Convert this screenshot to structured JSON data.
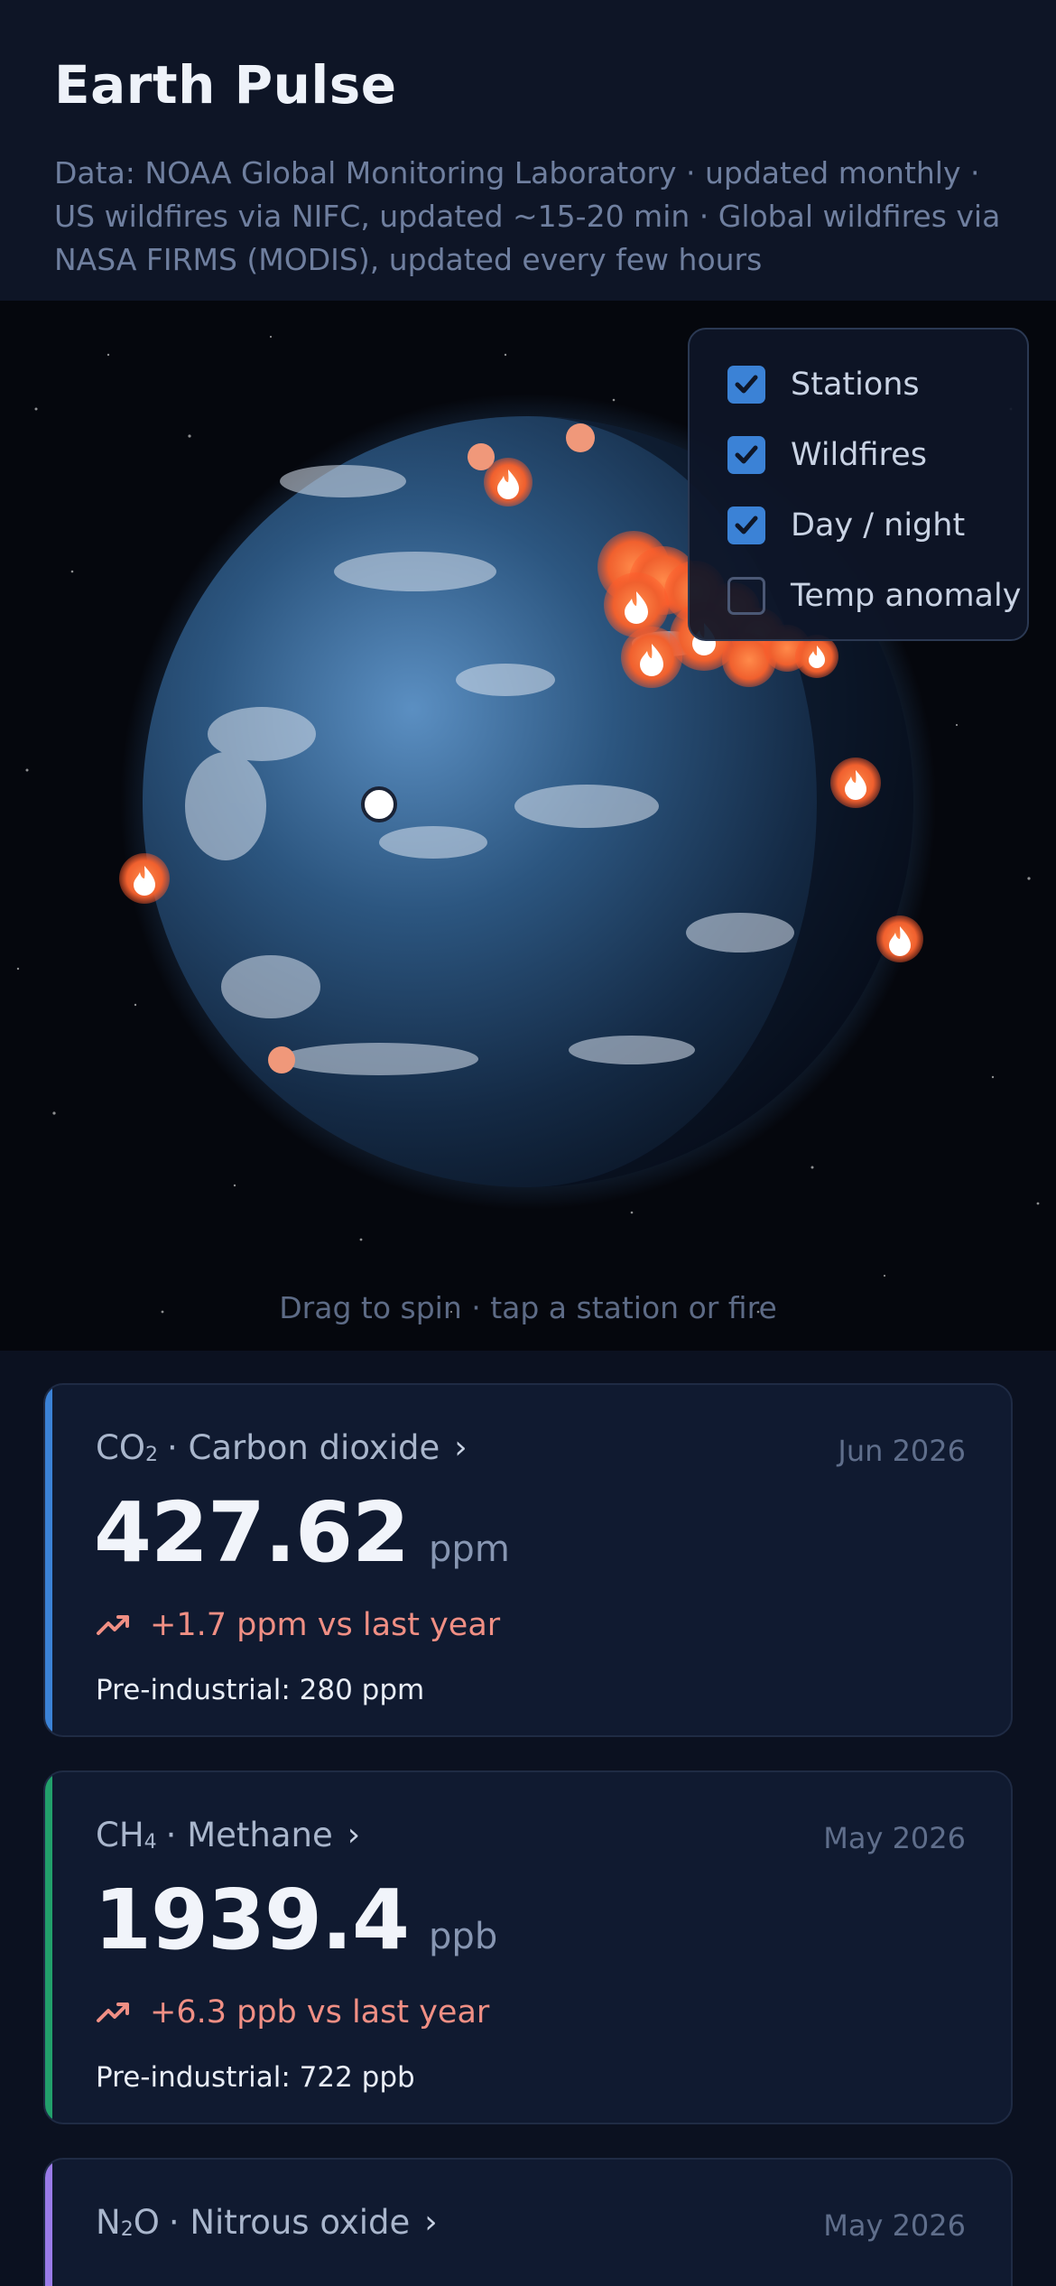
{
  "header": {
    "title": "Earth Pulse",
    "sources": "Data: NOAA Global Monitoring Laboratory · updated monthly · US wildfires via NIFC, updated ~15-20 min · Global wildfires via NASA FIRMS (MODIS), updated every few hours"
  },
  "globe": {
    "hint": "Drag to spin · tap a station or fire"
  },
  "layers": [
    {
      "label": "Stations",
      "checked": true
    },
    {
      "label": "Wildfires",
      "checked": true
    },
    {
      "label": "Day / night",
      "checked": true
    },
    {
      "label": "Temp anomaly",
      "checked": false
    }
  ],
  "cards": [
    {
      "formula": "CO",
      "subscript": "2",
      "name": "· Carbon dioxide",
      "date": "Jun 2026",
      "value": "427.62",
      "unit": "ppm",
      "change": "+1.7 ppm vs last year",
      "baseline": "Pre-industrial: 280 ppm",
      "accent": "#3b82d6"
    },
    {
      "formula": "CH",
      "subscript": "4",
      "name": "· Methane",
      "date": "May 2026",
      "value": "1939.4",
      "unit": "ppb",
      "change": "+6.3 ppb vs last year",
      "baseline": "Pre-industrial: 722 ppb",
      "accent": "#22a06b"
    },
    {
      "formula": "N",
      "subscript": "2",
      "formula_tail": "O",
      "name": "· Nitrous oxide",
      "date": "May 2026",
      "accent": "#9a7be8"
    }
  ],
  "colors": {
    "fire": "#f26a3a",
    "station": "#f0987a",
    "change_up": "#f08f84"
  },
  "icons": {
    "fire": "flame-icon",
    "trend": "trend-up-icon",
    "chevron": "chevron-right-icon",
    "check": "check-icon"
  }
}
